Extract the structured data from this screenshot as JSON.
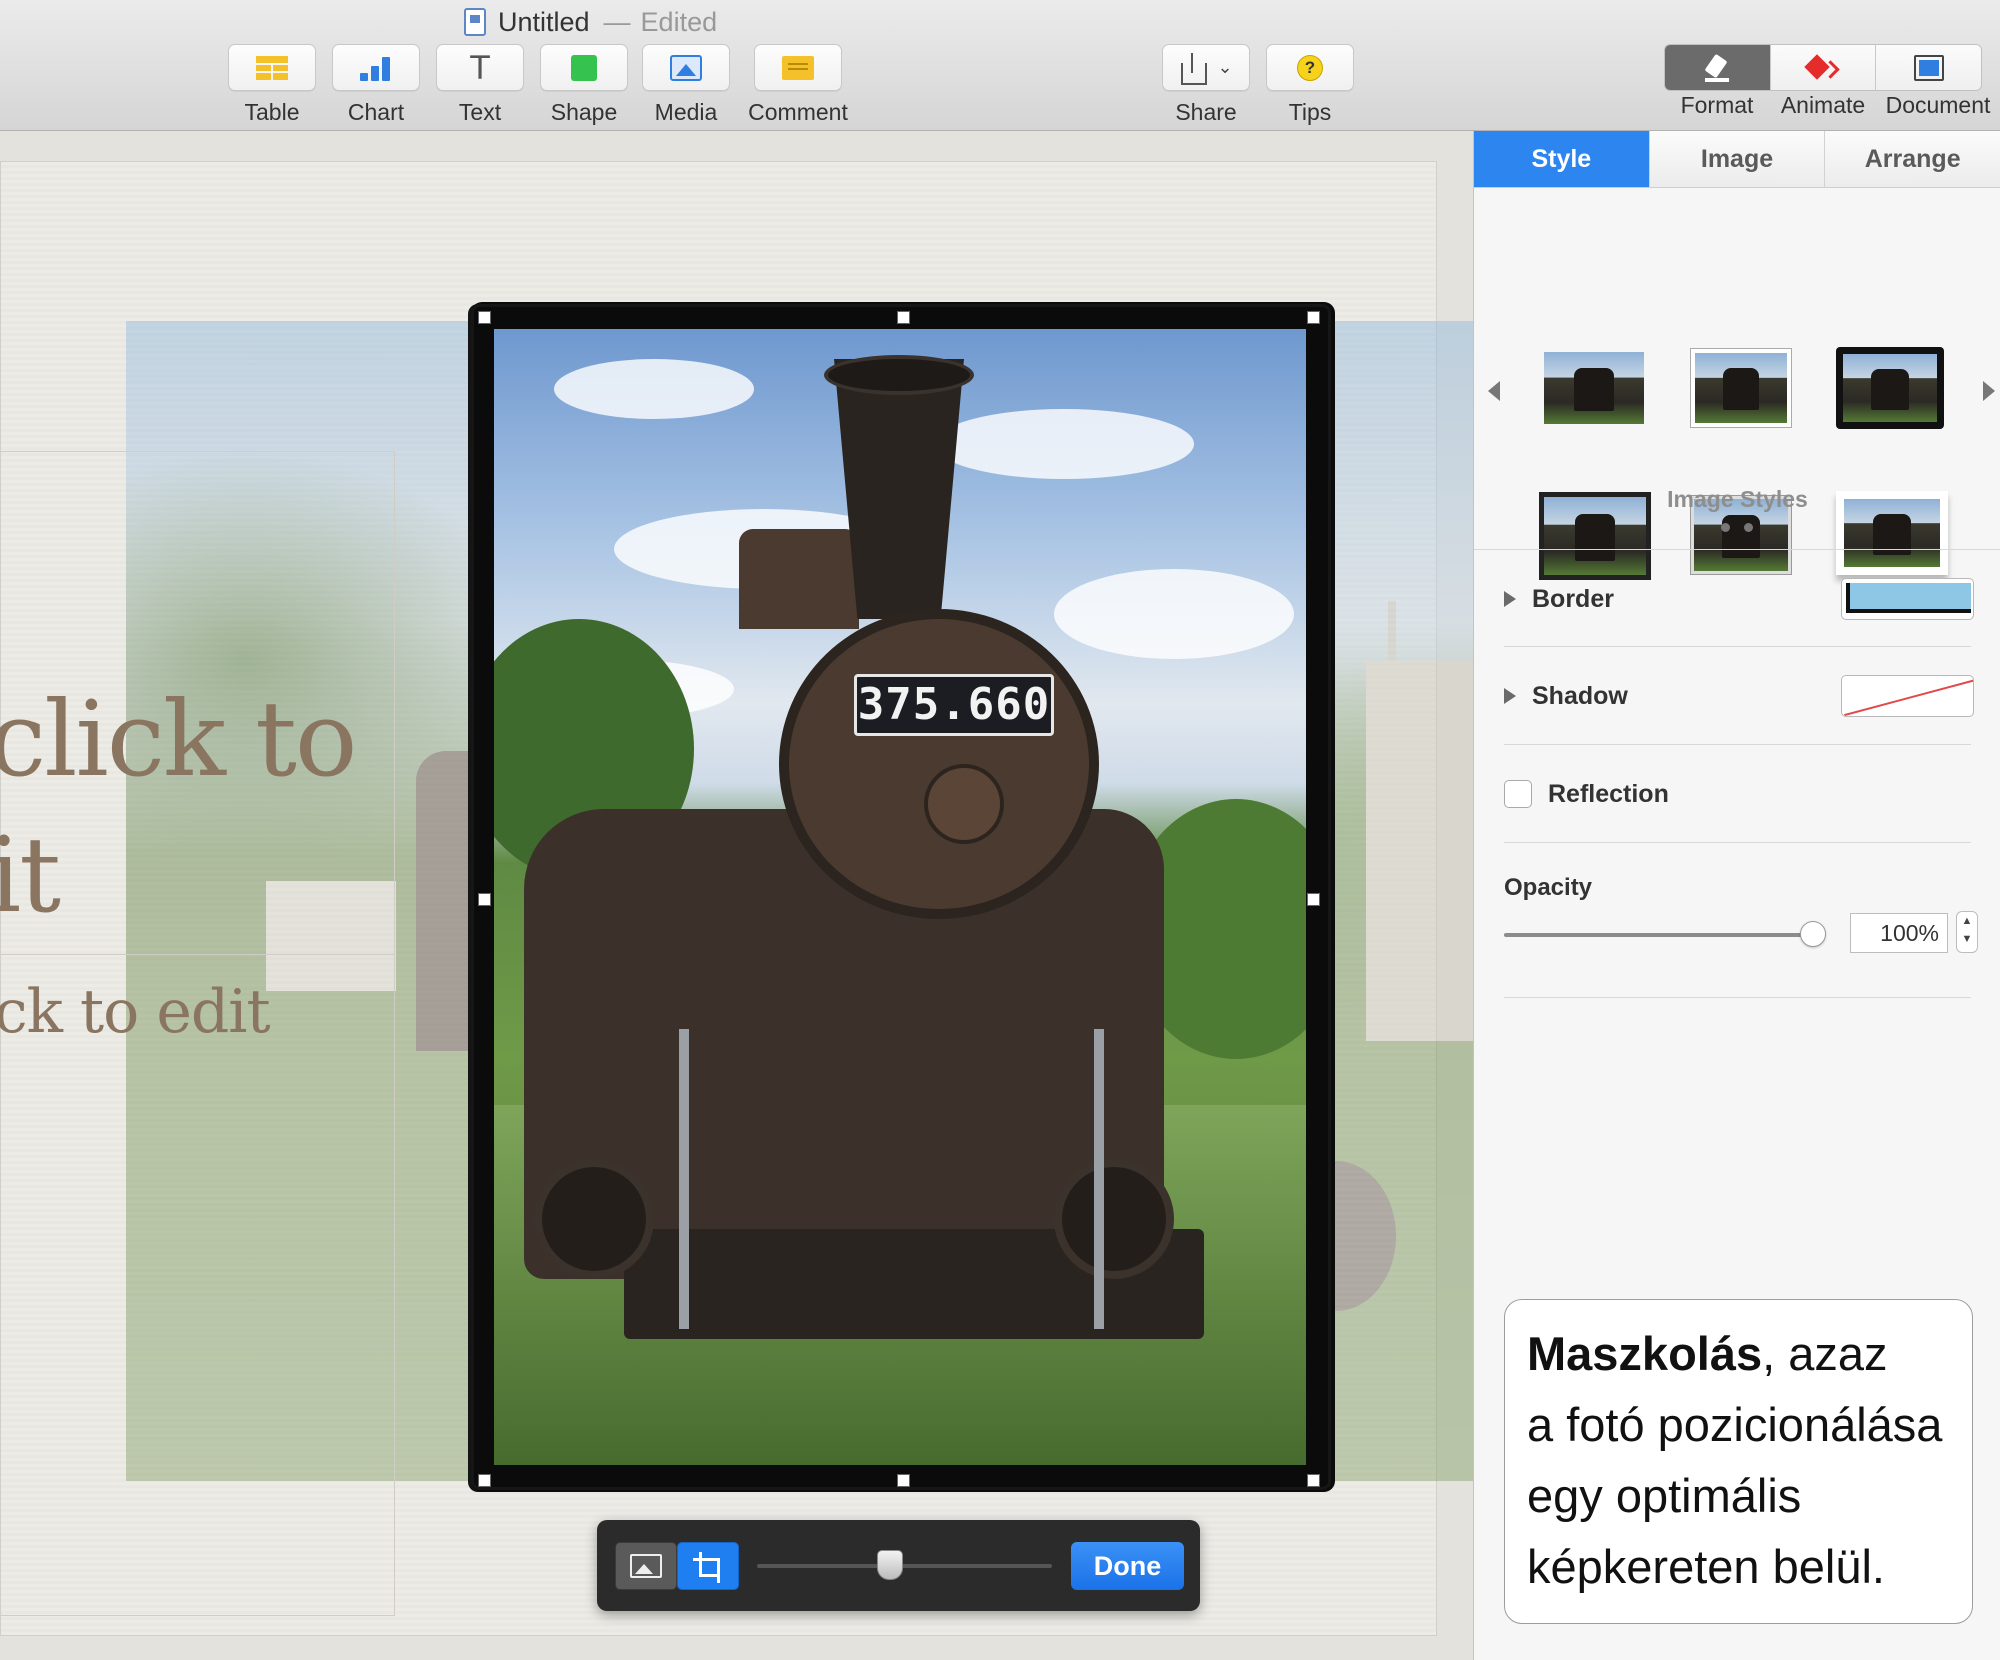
{
  "window": {
    "title": "Untitled",
    "status": "Edited"
  },
  "toolbar": {
    "left_buttons": [
      {
        "label": "Table",
        "icon": "table-icon"
      },
      {
        "label": "Chart",
        "icon": "chart-icon"
      },
      {
        "label": "Text",
        "icon": "text-icon"
      },
      {
        "label": "Shape",
        "icon": "shape-icon"
      },
      {
        "label": "Media",
        "icon": "media-icon"
      },
      {
        "label": "Comment",
        "icon": "comment-icon"
      }
    ],
    "text_glyph": "T",
    "share_label": "Share",
    "tips_label": "Tips",
    "tips_glyph": "?",
    "chevron_glyph": "⌄",
    "right_segments": [
      {
        "label": "Format",
        "icon": "format-brush-icon",
        "active": true
      },
      {
        "label": "Animate",
        "icon": "animate-icon",
        "active": false
      },
      {
        "label": "Document",
        "icon": "document-icon",
        "active": false
      }
    ]
  },
  "slide": {
    "title_placeholder_lines": [
      "click to",
      "it"
    ],
    "body_placeholder": "ck to edit",
    "locomotive_number": "375.660"
  },
  "mask_bar": {
    "done_label": "Done",
    "zoom_level": 0.45
  },
  "inspector": {
    "tabs": [
      {
        "label": "Style",
        "active": true
      },
      {
        "label": "Image",
        "active": false
      },
      {
        "label": "Arrange",
        "active": false
      }
    ],
    "image_styles_label": "Image Styles",
    "border_label": "Border",
    "shadow_label": "Shadow",
    "reflection_label": "Reflection",
    "reflection_checked": false,
    "opacity_label": "Opacity",
    "opacity_value": "100%"
  },
  "callout": {
    "bold": "Maszkolás",
    "rest_first_line": ", azaz",
    "lines": [
      "a fotó pozicionálása",
      "egy optimális",
      "képkereten belül."
    ]
  },
  "colors": {
    "accent": "#2d86ef",
    "done_button": "#1b72e8",
    "inspector_bg": "#f6f6f6"
  }
}
